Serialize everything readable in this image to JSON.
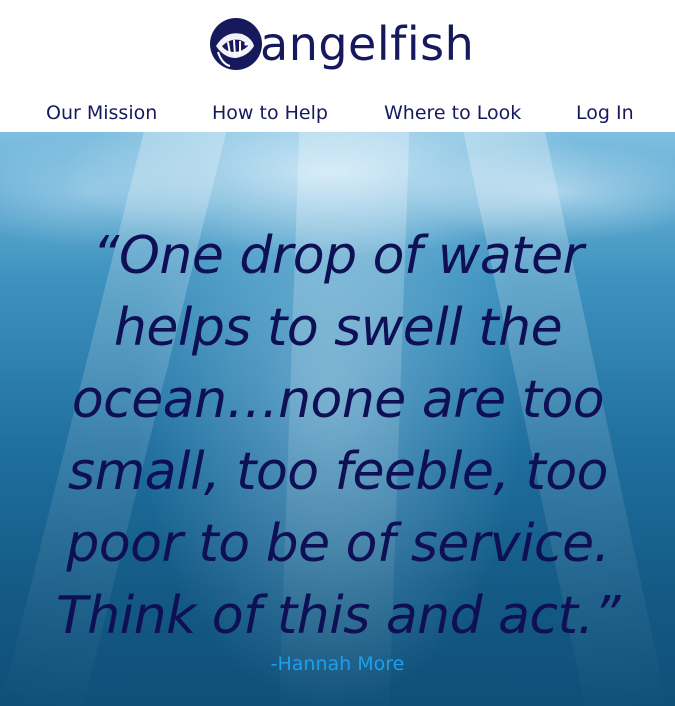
{
  "brand": {
    "name": "angelfish",
    "logo_icon": "angelfish-icon",
    "color": "#161a5c"
  },
  "nav": {
    "items": [
      {
        "label": "Our Mission"
      },
      {
        "label": "How to Help"
      },
      {
        "label": "Where to Look"
      },
      {
        "label": "Log In"
      }
    ]
  },
  "hero": {
    "quote_lines": [
      "“One drop of water",
      "helps to swell the",
      "ocean…none are too",
      "small, too feeble, too",
      "poor to be of service.",
      "Think of this and act.”"
    ],
    "attribution": "-Hannah More",
    "quote_color": "#0e0f55",
    "attribution_color": "#1aa0ee"
  }
}
